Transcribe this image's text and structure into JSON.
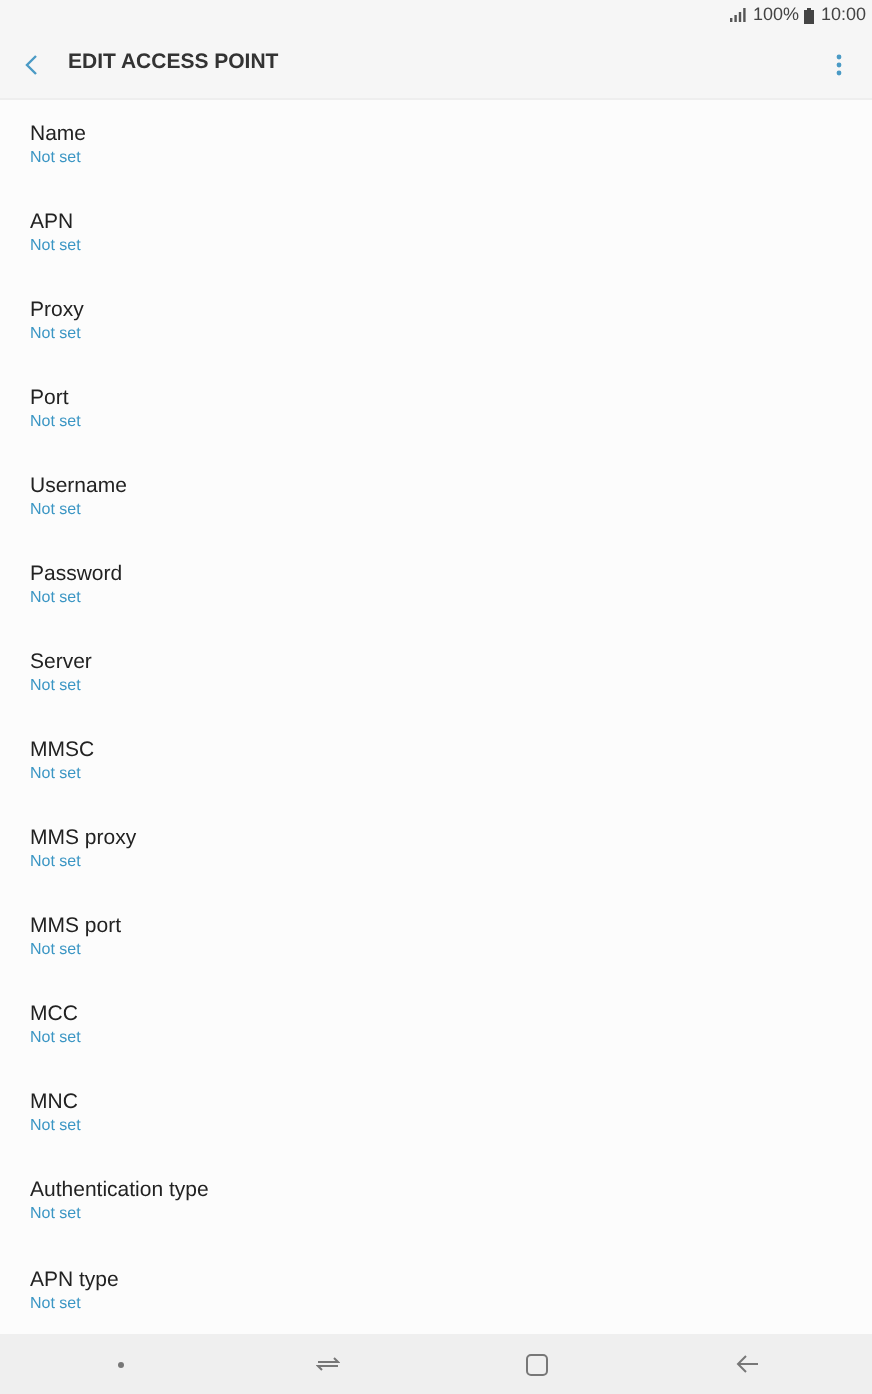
{
  "status_bar": {
    "battery": "100%",
    "time": "10:00"
  },
  "header": {
    "title": "EDIT ACCESS POINT"
  },
  "settings": [
    {
      "label": "Name",
      "value": "Not set"
    },
    {
      "label": "APN",
      "value": "Not set"
    },
    {
      "label": "Proxy",
      "value": "Not set"
    },
    {
      "label": "Port",
      "value": "Not set"
    },
    {
      "label": "Username",
      "value": "Not set"
    },
    {
      "label": "Password",
      "value": "Not set"
    },
    {
      "label": "Server",
      "value": "Not set"
    },
    {
      "label": "MMSC",
      "value": "Not set"
    },
    {
      "label": "MMS proxy",
      "value": "Not set"
    },
    {
      "label": "MMS port",
      "value": "Not set"
    },
    {
      "label": "MCC",
      "value": "Not set"
    },
    {
      "label": "MNC",
      "value": "Not set"
    },
    {
      "label": "Authentication type",
      "value": "Not set"
    },
    {
      "label": "APN type",
      "value": "Not set"
    }
  ]
}
